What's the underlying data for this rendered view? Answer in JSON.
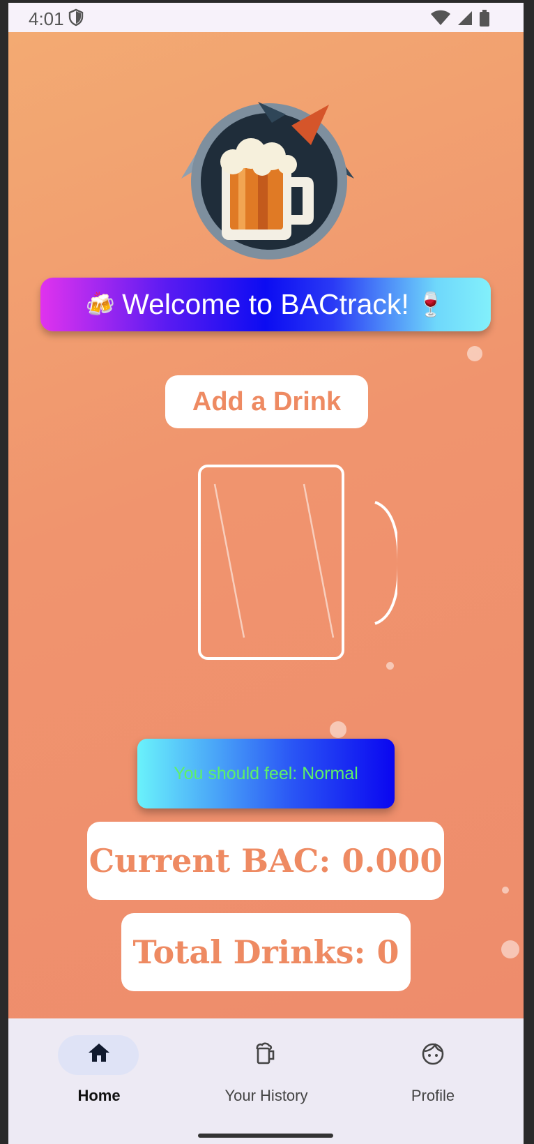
{
  "status_bar": {
    "time": "4:01",
    "icons": [
      "shield-icon",
      "wifi-icon",
      "signal-icon",
      "battery-icon"
    ]
  },
  "welcome_banner": {
    "text": "Welcome to BACtrack!",
    "leading_emoji": "🍻",
    "trailing_emoji": "🍷"
  },
  "add_drink_button": {
    "label": "Add a Drink"
  },
  "feel_card": {
    "text": "You should feel: Normal"
  },
  "stats": {
    "current_bac": "Current BAC: 0.000",
    "total_drinks": "Total Drinks: 0"
  },
  "bottom_nav": {
    "home": "Home",
    "history": "Your History",
    "profile": "Profile",
    "active": "Home"
  },
  "colors": {
    "background_start": "#f3aa72",
    "background_end": "#ee8c6c",
    "accent_text": "#ee8a62",
    "feel_text": "#5ef068",
    "nav_background": "#edeaf4"
  }
}
